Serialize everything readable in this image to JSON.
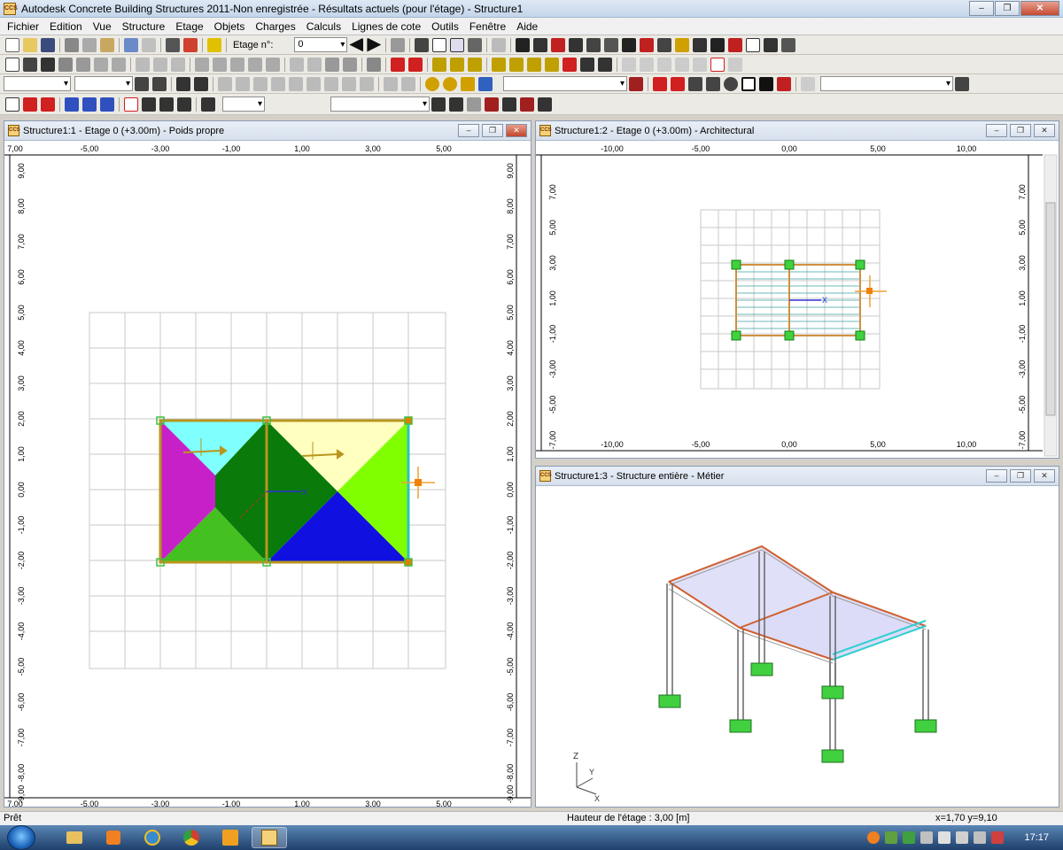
{
  "window": {
    "title": "Autodesk Concrete Building Structures 2011-Non enregistrée - Résultats actuels (pour l'étage) - Structure1",
    "icon_text": "ССS",
    "min_symbol": "–",
    "max_symbol": "❐",
    "close_symbol": "✕"
  },
  "menu": [
    "Fichier",
    "Edition",
    "Vue",
    "Structure",
    "Etage",
    "Objets",
    "Charges",
    "Calculs",
    "Lignes de cote",
    "Outils",
    "Fenêtre",
    "Aide"
  ],
  "toolbar": {
    "floor_label": "Etage n°:",
    "floor_value": "0"
  },
  "views": {
    "view1": {
      "title": "Structure1:1 - Etage 0 (+3.00m) - Poids propre",
      "x_ticks": [
        "-5,00",
        "-3,00",
        "-1,00",
        "1,00",
        "3,00",
        "5,00"
      ],
      "y_ticks": [
        "9,00",
        "8,00",
        "7,00",
        "6,00",
        "5,00",
        "4,00",
        "3,00",
        "2,00",
        "1,00",
        "0,00",
        "-1,00",
        "-2,00",
        "-3,00",
        "-4,00",
        "-5,00",
        "-6,00",
        "-7,00",
        "-8,00",
        "-9,00"
      ],
      "corner_label": "7,00"
    },
    "view2": {
      "title": "Structure1:2 - Etage 0 (+3.00m) - Architectural",
      "x_ticks": [
        "-10,00",
        "-5,00",
        "0,00",
        "5,00",
        "10,00"
      ],
      "y_ticks": [
        "7,00",
        "5,00",
        "3,00",
        "1,00",
        "-1,00",
        "-3,00",
        "-5,00",
        "-7,00"
      ],
      "axis_x": "X"
    },
    "view3": {
      "title": "Structure1:3 - Structure entière - Métier",
      "axes": {
        "z": "Z",
        "y": "Y",
        "x": "X"
      }
    }
  },
  "status": {
    "left": "Prêt",
    "middle": "Hauteur de l'étage : 3,00 [m]",
    "right": "x=1,70 y=9,10"
  },
  "taskbar": {
    "clock": "17:17"
  },
  "colors": {
    "slab_magenta": "#c820c8",
    "slab_cyan": "#80ffff",
    "slab_darkgreen": "#0a7a0a",
    "slab_green": "#44c020",
    "slab_lightyellow": "#ffffc0",
    "slab_lime": "#80ff00",
    "slab_blue": "#1010e0",
    "beam": "#b8961e",
    "node": "#40d040"
  }
}
